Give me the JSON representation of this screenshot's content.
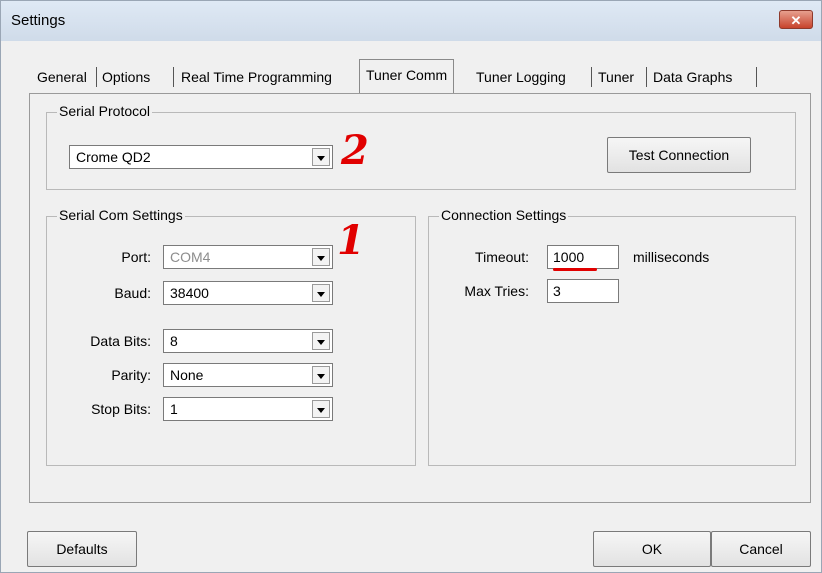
{
  "window": {
    "title": "Settings",
    "close_label": "✕"
  },
  "tabs": [
    {
      "label": "General"
    },
    {
      "label": "Options"
    },
    {
      "label": "Real Time Programming"
    },
    {
      "label": "Tuner Comm",
      "active": true
    },
    {
      "label": "Tuner Logging"
    },
    {
      "label": "Tuner"
    },
    {
      "label": "Data Graphs"
    }
  ],
  "serial_protocol": {
    "legend": "Serial Protocol",
    "protocol_value": "Crome QD2",
    "test_button": "Test Connection",
    "annotation": "2"
  },
  "serial_com": {
    "legend": "Serial Com Settings",
    "annotation": "1",
    "port_label": "Port:",
    "port_value": "COM4",
    "baud_label": "Baud:",
    "baud_value": "38400",
    "databits_label": "Data Bits:",
    "databits_value": "8",
    "parity_label": "Parity:",
    "parity_value": "None",
    "stopbits_label": "Stop Bits:",
    "stopbits_value": "1"
  },
  "connection": {
    "legend": "Connection Settings",
    "timeout_label": "Timeout:",
    "timeout_value": "1000",
    "timeout_unit": "milliseconds",
    "maxtries_label": "Max Tries:",
    "maxtries_value": "3"
  },
  "footer": {
    "defaults_label": "Defaults",
    "ok_label": "OK",
    "cancel_label": "Cancel"
  },
  "colors": {
    "annotation": "#e10000",
    "title_bar": "#dfe9f5",
    "close_button": "#c7432c"
  }
}
